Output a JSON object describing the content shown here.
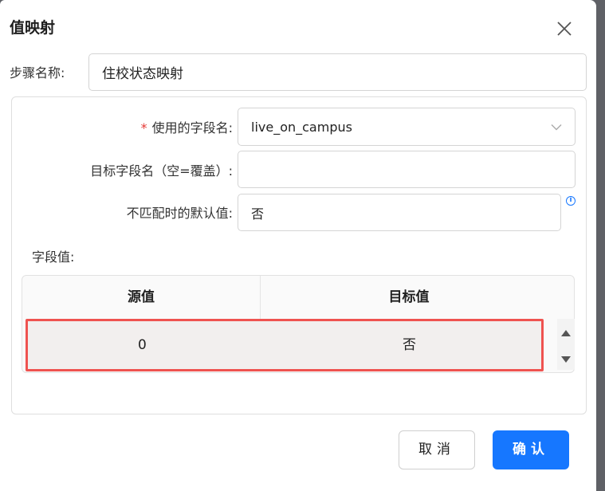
{
  "dialog": {
    "title": "值映射",
    "step_name_label": "步骤名称:",
    "step_name_value": "住校状态映射"
  },
  "form": {
    "field_name_required_mark": "*",
    "field_name_label": "使用的字段名:",
    "field_name_value": "live_on_campus",
    "target_field_label": "目标字段名（空=覆盖）:",
    "target_field_value": "",
    "default_value_label": "不匹配时的默认值:",
    "default_value_value": "否",
    "field_values_label": "字段值:"
  },
  "table": {
    "headers": [
      "源值",
      "目标值"
    ],
    "rows": [
      {
        "source": "0",
        "target": "否"
      }
    ]
  },
  "buttons": {
    "cancel": "取消",
    "ok": "确认"
  },
  "colors": {
    "primary": "#1677ff",
    "highlight": "#ef5350",
    "required": "#e53935"
  },
  "icons": [
    "close-icon",
    "chevron-down-icon",
    "info-icon",
    "scroll-up-icon",
    "scroll-down-icon"
  ]
}
